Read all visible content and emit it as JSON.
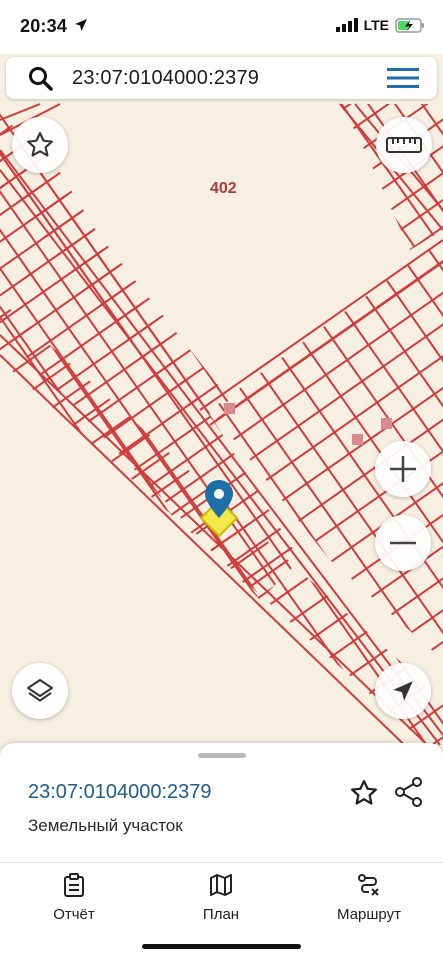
{
  "status_bar": {
    "time": "20:34",
    "network": "LTE",
    "icons": [
      "location-arrow-icon",
      "signal-bars-icon",
      "battery-charging-icon"
    ]
  },
  "search": {
    "value": "23:07:0104000:2379",
    "icons": [
      "search-icon",
      "hamburger-menu-icon"
    ]
  },
  "map": {
    "block_label": "402",
    "parcel_color": "#d23b3b",
    "background_color": "#f6efe2",
    "marker_color": "#1e6fa8",
    "selected_parcel_color": "#f5e84a",
    "controls": [
      "favorite-star-icon",
      "ruler-icon",
      "zoom-in-icon",
      "zoom-out-icon",
      "layers-icon",
      "my-location-icon"
    ]
  },
  "sheet": {
    "cadastral_number": "23:07:0104000:2379",
    "object_type": "Земельный участок",
    "accent_color": "#1f5c8e"
  },
  "tabs": [
    {
      "label": "Отчёт",
      "icon": "clipboard-icon"
    },
    {
      "label": "План",
      "icon": "map-icon"
    },
    {
      "label": "Маршрут",
      "icon": "route-icon"
    }
  ]
}
